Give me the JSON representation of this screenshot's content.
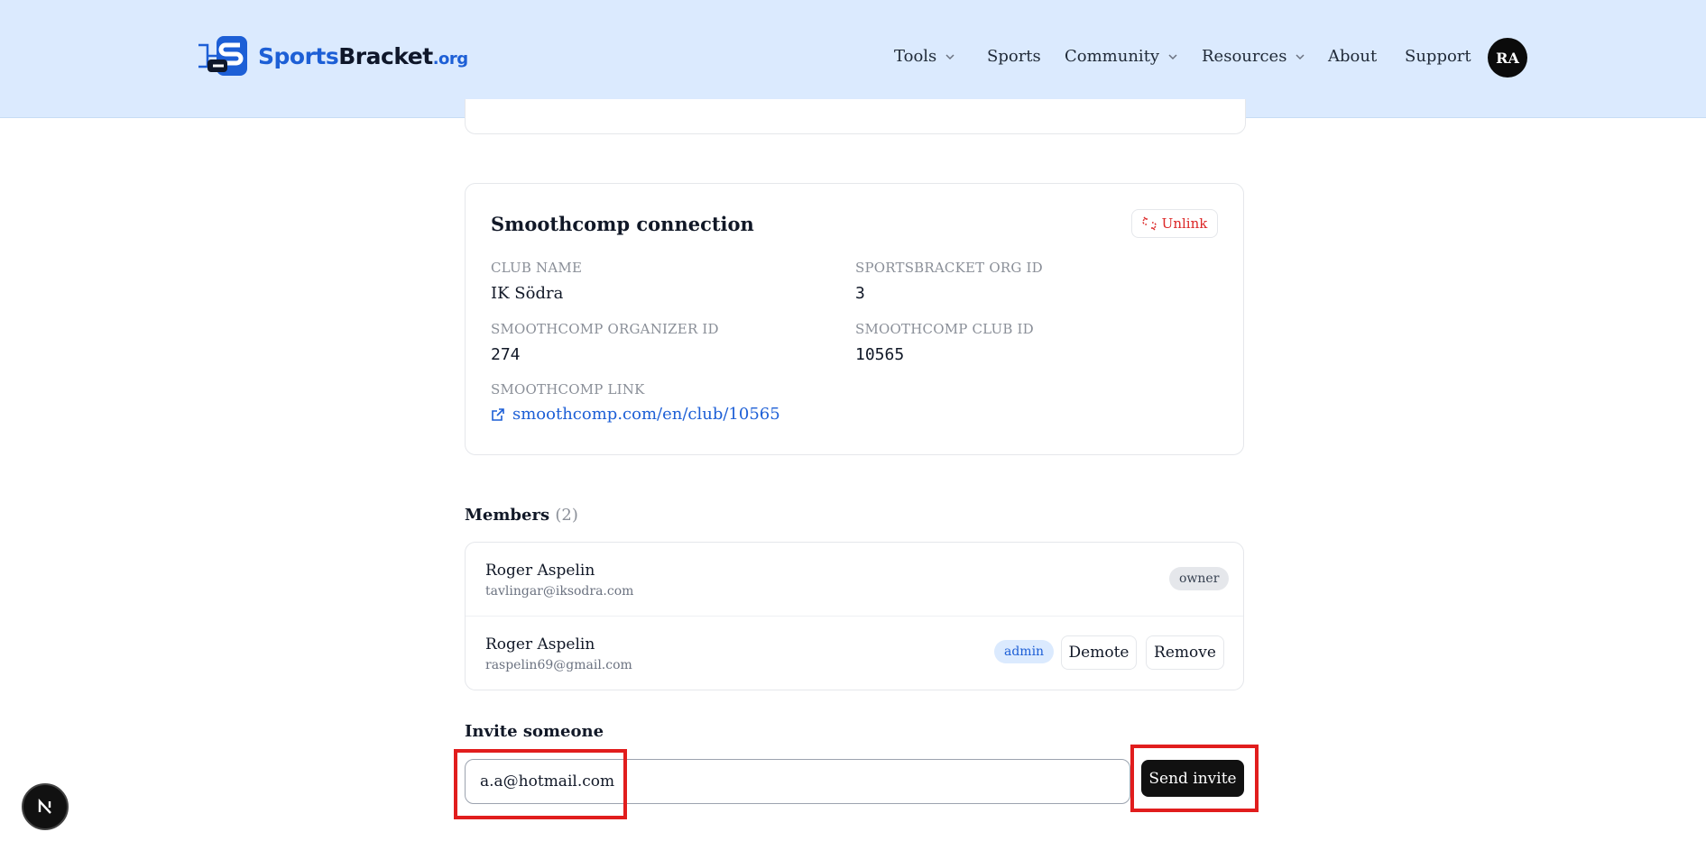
{
  "brand": {
    "part1": "Sports",
    "part2": "Bracket",
    "part3": ".org"
  },
  "nav": {
    "tools": "Tools",
    "sports": "Sports",
    "community": "Community",
    "resources": "Resources",
    "about": "About",
    "support": "Support",
    "avatar_initials": "RA"
  },
  "smoothcomp": {
    "title": "Smoothcomp connection",
    "unlink_label": "Unlink",
    "club_name_label": "CLUB NAME",
    "club_name": "IK Södra",
    "org_id_label": "SPORTSBRACKET ORG ID",
    "org_id": "3",
    "organizer_id_label": "SMOOTHCOMP ORGANIZER ID",
    "organizer_id": "274",
    "club_id_label": "SMOOTHCOMP CLUB ID",
    "club_id": "10565",
    "link_label": "SMOOTHCOMP LINK",
    "link_text": "smoothcomp.com/en/club/10565"
  },
  "members": {
    "heading": "Members",
    "count": "(2)",
    "list": [
      {
        "name": "Roger Aspelin",
        "email": "tavlingar@iksodra.com",
        "role": "owner"
      },
      {
        "name": "Roger Aspelin",
        "email": "raspelin69@gmail.com",
        "role": "admin",
        "demote_label": "Demote",
        "remove_label": "Remove"
      }
    ]
  },
  "invite": {
    "heading": "Invite someone",
    "email_value": "a.a@hotmail.com",
    "send_label": "Send invite"
  },
  "colors": {
    "accent": "#1d5fd6",
    "header_bg": "#dbeafe",
    "danger": "#dc2626",
    "highlight": "#e11d1d"
  },
  "icons": {
    "unlink": "unlink-icon",
    "external_link": "external-link-icon",
    "dev": "nextjs-icon"
  }
}
